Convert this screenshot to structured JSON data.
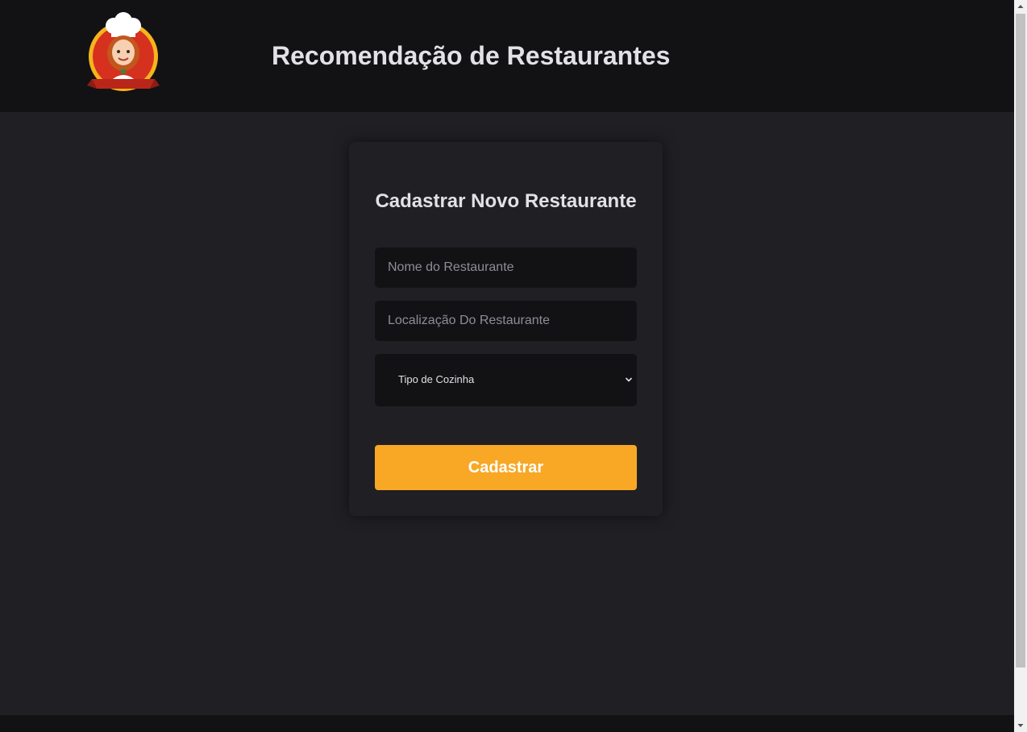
{
  "header": {
    "title": "Recomendação de Restaurantes",
    "logo_icon": "chef-logo-icon"
  },
  "form": {
    "title": "Cadastrar Novo Restaurante",
    "name_placeholder": "Nome do Restaurante",
    "location_placeholder": "Localização Do Restaurante",
    "cuisine_select_value": "Tipo de Cozinha",
    "submit_label": "Cadastrar"
  },
  "colors": {
    "page_background": "#202024",
    "header_background": "#121214",
    "input_background": "#121214",
    "accent": "#f8a825",
    "text": "#e1e1e6",
    "placeholder": "#8d8d99"
  }
}
